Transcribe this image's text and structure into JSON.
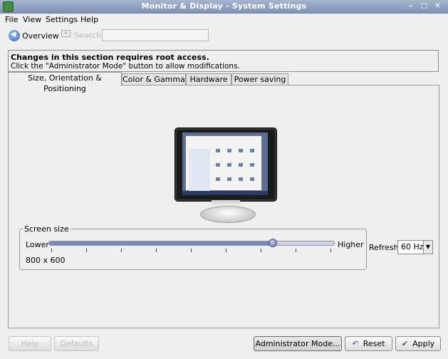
{
  "window": {
    "title": "Monitor & Display - System Settings"
  },
  "menubar": {
    "items": [
      "File",
      "View",
      "Settings",
      "Help"
    ]
  },
  "toolbar": {
    "overview_label": "Overview",
    "search_label": "Search:",
    "search_value": ""
  },
  "notice": {
    "line1": "Changes in this section requires root access.",
    "line2": "Click the \"Administrator Mode\" button to allow modifications."
  },
  "tabs": [
    {
      "label": "Size, Orientation & Positioning",
      "active": true
    },
    {
      "label": "Color & Gamma",
      "active": false
    },
    {
      "label": "Hardware",
      "active": false
    },
    {
      "label": "Power saving",
      "active": false
    }
  ],
  "screen_size": {
    "group_label": "Screen size",
    "lower_label": "Lower",
    "higher_label": "Higher",
    "resolution": "800 x 600",
    "slider_level": 0.8,
    "tick_count": 9
  },
  "refresh": {
    "label": "Refresh:",
    "value": "60 Hz"
  },
  "buttons": {
    "help": "Help",
    "defaults": "Defaults",
    "admin_mode": "Administrator Mode...",
    "reset": "Reset",
    "apply": "Apply"
  },
  "colors": {
    "accent": "#7b86b5",
    "title_bar": "#8c9dbf"
  }
}
